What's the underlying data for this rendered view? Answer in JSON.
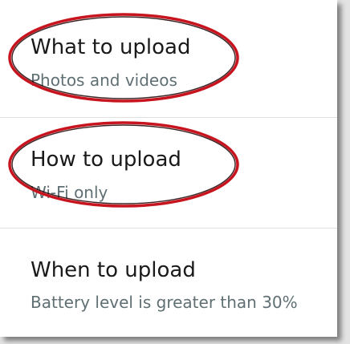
{
  "settings": {
    "items": [
      {
        "title": "What to upload",
        "subtitle": "Photos and videos"
      },
      {
        "title": "How to upload",
        "subtitle": "Wi-Fi only"
      },
      {
        "title": "When to upload",
        "subtitle": "Battery level is greater than 30%"
      }
    ]
  },
  "colors": {
    "highlight_ring": "#c8141e",
    "title_text": "#1a1a1a",
    "subtitle_text": "#5f6f73"
  }
}
